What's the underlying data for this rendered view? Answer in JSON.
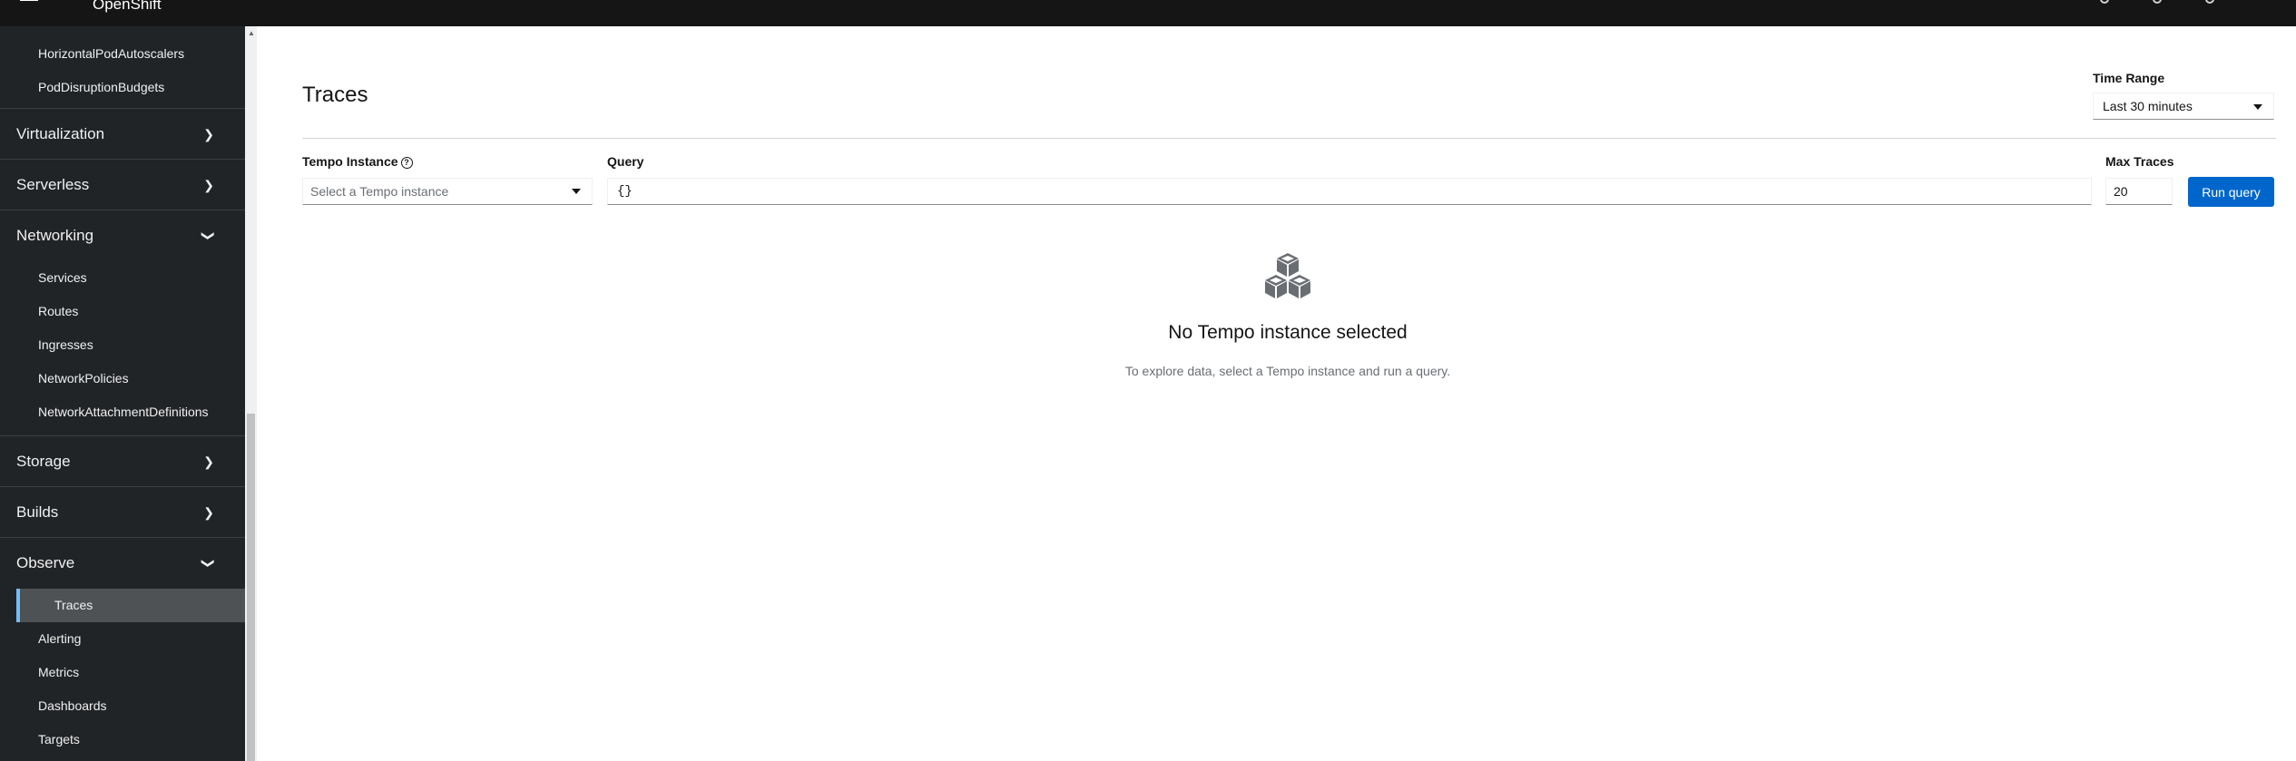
{
  "masthead": {
    "brand": "OpenShift"
  },
  "sidebar": {
    "top_items": [
      {
        "label": "HorizontalPodAutoscalers"
      },
      {
        "label": "PodDisruptionBudgets"
      }
    ],
    "sections": {
      "virtualization": "Virtualization",
      "serverless": "Serverless",
      "networking": "Networking",
      "storage": "Storage",
      "builds": "Builds",
      "observe": "Observe"
    },
    "networking_items": [
      "Services",
      "Routes",
      "Ingresses",
      "NetworkPolicies",
      "NetworkAttachmentDefinitions"
    ],
    "observe_items": [
      "Traces",
      "Alerting",
      "Metrics",
      "Dashboards",
      "Targets"
    ],
    "active_item": "Traces"
  },
  "page": {
    "title": "Traces",
    "time_range_label": "Time Range",
    "time_range_value": "Last 30 minutes",
    "tempo_label": "Tempo Instance",
    "tempo_placeholder": "Select a Tempo instance",
    "query_label": "Query",
    "query_value": "{}",
    "max_traces_label": "Max Traces",
    "max_traces_value": "20",
    "run_query_label": "Run query",
    "empty_title": "No Tempo instance selected",
    "empty_body": "To explore data, select a Tempo instance and run a query."
  },
  "colors": {
    "accent": "#0066cc",
    "sidebar_bg": "#212427",
    "active_border": "#73bcf7"
  }
}
